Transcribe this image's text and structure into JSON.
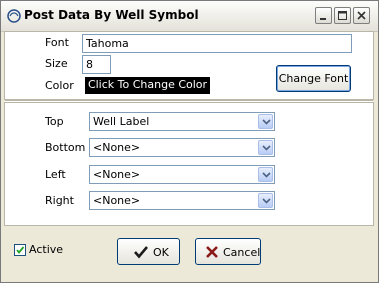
{
  "window": {
    "title": "Post Data By Well Symbol"
  },
  "font_section": {
    "font_label": "Font",
    "font_value": "Tahoma",
    "size_label": "Size",
    "size_value": "8",
    "color_label": "Color",
    "color_button_label": "Click To Change Color",
    "color_value": "#000000",
    "change_font_label": "Change Font"
  },
  "positions": {
    "top": {
      "label": "Top",
      "value": "Well Label"
    },
    "bottom": {
      "label": "Bottom",
      "value": "<None>"
    },
    "left": {
      "label": "Left",
      "value": "<None>"
    },
    "right": {
      "label": "Right",
      "value": "<None>"
    }
  },
  "footer": {
    "active_label": "Active",
    "active_checked": true,
    "ok_label": "OK",
    "cancel_label": "Cancel"
  }
}
